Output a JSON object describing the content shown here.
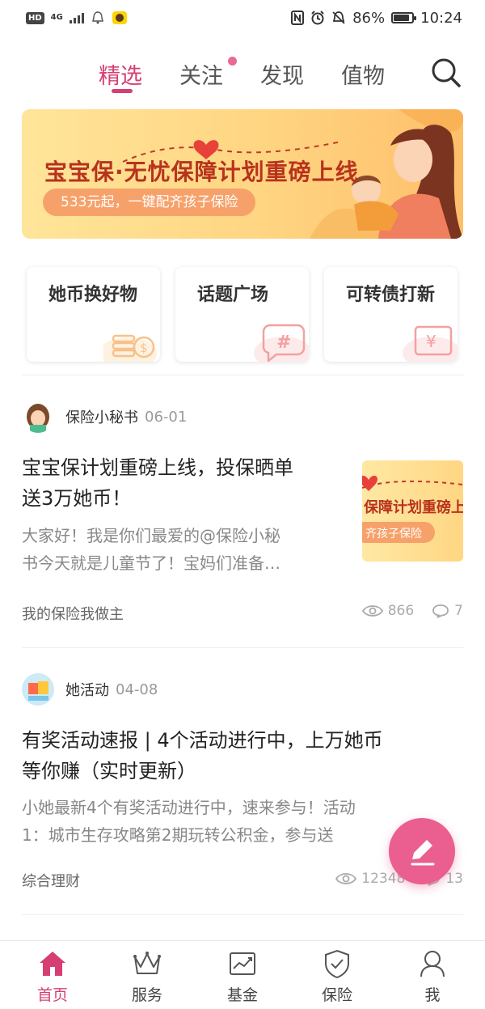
{
  "status_bar": {
    "badge": "HD",
    "network": "4G",
    "battery": "86%",
    "battery_level": 0.86,
    "time": "10:24"
  },
  "top_tabs": [
    {
      "label": "精选",
      "active": true
    },
    {
      "label": "关注",
      "active": false,
      "has_dot": true
    },
    {
      "label": "发现",
      "active": false
    },
    {
      "label": "值物",
      "active": false
    }
  ],
  "banner": {
    "title": "宝宝保·无忧保障计划重磅上线",
    "subtitle": "533元起，一键配齐孩子保险"
  },
  "shortcuts": [
    {
      "label": "她币换好物",
      "icon": "coin-stack-icon"
    },
    {
      "label": "话题广场",
      "icon": "hashtag-bubble-icon"
    },
    {
      "label": "可转债打新",
      "icon": "yen-ticket-icon"
    }
  ],
  "posts": [
    {
      "author": "保险小秘书",
      "date": "06-01",
      "title_lines": [
        "宝宝保计划重磅上线，投保晒单",
        "送3万她币！"
      ],
      "excerpt_lines": [
        "大家好！我是你们最爱的@保险小秘",
        "书今天就是儿童节了！宝妈们准备…"
      ],
      "topic": "我的保险我做主",
      "views": "866",
      "comments": "7",
      "thumb_text_1": "保障计划重磅上",
      "thumb_text_2": "齐孩子保险"
    },
    {
      "author": "她活动",
      "date": "04-08",
      "title_lines": [
        "有奖活动速报 | 4个活动进行中，上万她币",
        "等你赚（实时更新）"
      ],
      "excerpt_lines": [
        "小她最新4个有奖活动进行中，速来参与！活动",
        "1：城市生存攻略第2期玩转公积金，参与送"
      ],
      "topic": "综合理财",
      "views": "12348",
      "comments": "13"
    }
  ],
  "bottom_nav": [
    {
      "label": "首页",
      "active": true
    },
    {
      "label": "服务",
      "active": false
    },
    {
      "label": "基金",
      "active": false
    },
    {
      "label": "保险",
      "active": false
    },
    {
      "label": "我",
      "active": false
    }
  ],
  "colors": {
    "accent": "#d63f74",
    "fab": "#ea5f8f",
    "banner_title": "#b8321e"
  }
}
